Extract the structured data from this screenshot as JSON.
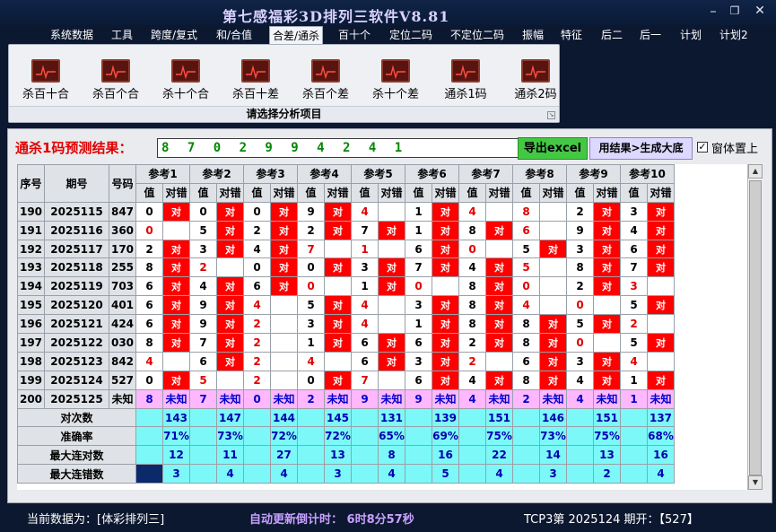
{
  "window": {
    "title": "第七感福彩3D排列三软件V8.81",
    "controls": [
      "minimize",
      "restore",
      "close"
    ]
  },
  "menu": [
    {
      "label": "系统数据",
      "active": false
    },
    {
      "label": "工具",
      "active": false
    },
    {
      "label": "跨度/复式",
      "active": false
    },
    {
      "label": "和/合值",
      "active": false
    },
    {
      "label": "合差/通杀",
      "active": true
    },
    {
      "label": "百十个",
      "active": false
    },
    {
      "label": "定位二码",
      "active": false
    },
    {
      "label": "不定位二码",
      "active": false
    },
    {
      "label": "振幅",
      "active": false
    },
    {
      "label": "特征",
      "active": false
    },
    {
      "label": "后二",
      "active": false
    },
    {
      "label": "后一",
      "active": false
    },
    {
      "label": "计划",
      "active": false
    },
    {
      "label": "计划2",
      "active": false
    }
  ],
  "ribbon": {
    "tools": [
      {
        "label": "杀百十合",
        "icon": "chart-icon"
      },
      {
        "label": "杀百个合",
        "icon": "chart-icon"
      },
      {
        "label": "杀十个合",
        "icon": "chart-icon"
      },
      {
        "label": "杀百十差",
        "icon": "chart-icon"
      },
      {
        "label": "杀百个差",
        "icon": "chart-icon"
      },
      {
        "label": "杀十个差",
        "icon": "chart-icon"
      },
      {
        "label": "通杀1码",
        "icon": "chart-icon"
      },
      {
        "label": "通杀2码",
        "icon": "chart-icon"
      }
    ],
    "footer": "请选择分析项目"
  },
  "result": {
    "label": "通杀1码预测结果：",
    "value": "8 7 0 2 9 9 4 2 4 1",
    "export_button": "导出excel",
    "generate_button": "用结果>生成大底",
    "ontop_checked": true,
    "ontop_label": "窗体置上"
  },
  "table": {
    "headers": {
      "index": "序号",
      "term": "期号",
      "code": "号码",
      "value": "值",
      "result": "对错"
    },
    "groups": [
      "参考1",
      "参考2",
      "参考3",
      "参考4",
      "参考5",
      "参考6",
      "参考7",
      "参考8",
      "参考9",
      "参考10"
    ],
    "hit_text": "对",
    "rows": [
      {
        "index": "190",
        "term": "2025115",
        "code": "847",
        "refs": [
          [
            "0",
            1
          ],
          [
            "0",
            1
          ],
          [
            "0",
            1
          ],
          [
            "9",
            1
          ],
          [
            "4",
            0
          ],
          [
            "1",
            1
          ],
          [
            "4",
            0
          ],
          [
            "8",
            0
          ],
          [
            "2",
            1
          ],
          [
            "3",
            1
          ]
        ]
      },
      {
        "index": "191",
        "term": "2025116",
        "code": "360",
        "refs": [
          [
            "0",
            0
          ],
          [
            "5",
            1
          ],
          [
            "2",
            1
          ],
          [
            "2",
            1
          ],
          [
            "7",
            1
          ],
          [
            "1",
            1
          ],
          [
            "8",
            1
          ],
          [
            "6",
            0
          ],
          [
            "9",
            1
          ],
          [
            "4",
            1
          ]
        ]
      },
      {
        "index": "192",
        "term": "2025117",
        "code": "170",
        "refs": [
          [
            "2",
            1
          ],
          [
            "3",
            1
          ],
          [
            "4",
            1
          ],
          [
            "7",
            0
          ],
          [
            "1",
            0
          ],
          [
            "6",
            1
          ],
          [
            "0",
            0
          ],
          [
            "5",
            1
          ],
          [
            "3",
            1
          ],
          [
            "6",
            1
          ]
        ]
      },
      {
        "index": "193",
        "term": "2025118",
        "code": "255",
        "refs": [
          [
            "8",
            1
          ],
          [
            "2",
            0
          ],
          [
            "0",
            1
          ],
          [
            "0",
            1
          ],
          [
            "3",
            1
          ],
          [
            "7",
            1
          ],
          [
            "4",
            1
          ],
          [
            "5",
            0
          ],
          [
            "8",
            1
          ],
          [
            "7",
            1
          ]
        ]
      },
      {
        "index": "194",
        "term": "2025119",
        "code": "703",
        "refs": [
          [
            "6",
            1
          ],
          [
            "4",
            1
          ],
          [
            "6",
            1
          ],
          [
            "0",
            0
          ],
          [
            "1",
            1
          ],
          [
            "0",
            0
          ],
          [
            "8",
            1
          ],
          [
            "0",
            0
          ],
          [
            "2",
            1
          ],
          [
            "3",
            0
          ]
        ]
      },
      {
        "index": "195",
        "term": "2025120",
        "code": "401",
        "refs": [
          [
            "6",
            1
          ],
          [
            "9",
            1
          ],
          [
            "4",
            0
          ],
          [
            "5",
            1
          ],
          [
            "4",
            0
          ],
          [
            "3",
            1
          ],
          [
            "8",
            1
          ],
          [
            "4",
            0
          ],
          [
            "0",
            0
          ],
          [
            "5",
            1
          ]
        ]
      },
      {
        "index": "196",
        "term": "2025121",
        "code": "424",
        "refs": [
          [
            "6",
            1
          ],
          [
            "9",
            1
          ],
          [
            "2",
            0
          ],
          [
            "3",
            1
          ],
          [
            "4",
            0
          ],
          [
            "1",
            1
          ],
          [
            "8",
            1
          ],
          [
            "8",
            1
          ],
          [
            "5",
            1
          ],
          [
            "2",
            0
          ]
        ]
      },
      {
        "index": "197",
        "term": "2025122",
        "code": "030",
        "refs": [
          [
            "8",
            1
          ],
          [
            "7",
            1
          ],
          [
            "2",
            0
          ],
          [
            "1",
            1
          ],
          [
            "6",
            1
          ],
          [
            "6",
            1
          ],
          [
            "2",
            1
          ],
          [
            "8",
            1
          ],
          [
            "0",
            0
          ],
          [
            "5",
            1
          ]
        ]
      },
      {
        "index": "198",
        "term": "2025123",
        "code": "842",
        "refs": [
          [
            "4",
            0
          ],
          [
            "6",
            1
          ],
          [
            "2",
            0
          ],
          [
            "4",
            0
          ],
          [
            "6",
            1
          ],
          [
            "3",
            1
          ],
          [
            "2",
            0
          ],
          [
            "6",
            1
          ],
          [
            "3",
            1
          ],
          [
            "4",
            0
          ]
        ]
      },
      {
        "index": "199",
        "term": "2025124",
        "code": "527",
        "refs": [
          [
            "0",
            1
          ],
          [
            "5",
            0
          ],
          [
            "2",
            0
          ],
          [
            "0",
            1
          ],
          [
            "7",
            0
          ],
          [
            "6",
            1
          ],
          [
            "4",
            1
          ],
          [
            "8",
            1
          ],
          [
            "4",
            1
          ],
          [
            "1",
            1
          ]
        ]
      },
      {
        "index": "200",
        "term": "2025125",
        "code": "未知",
        "pending": true,
        "refs": [
          [
            "8",
            "未知"
          ],
          [
            "7",
            "未知"
          ],
          [
            "0",
            "未知"
          ],
          [
            "2",
            "未知"
          ],
          [
            "9",
            "未知"
          ],
          [
            "9",
            "未知"
          ],
          [
            "4",
            "未知"
          ],
          [
            "2",
            "未知"
          ],
          [
            "4",
            "未知"
          ],
          [
            "1",
            "未知"
          ]
        ]
      }
    ],
    "stats": [
      {
        "label": "对次数",
        "values": [
          "143",
          "147",
          "144",
          "145",
          "131",
          "139",
          "151",
          "146",
          "151",
          "137"
        ]
      },
      {
        "label": "准确率",
        "values": [
          "71%",
          "73%",
          "72%",
          "72%",
          "65%",
          "69%",
          "75%",
          "73%",
          "75%",
          "68%"
        ]
      },
      {
        "label": "最大连对数",
        "values": [
          "12",
          "11",
          "27",
          "13",
          "8",
          "16",
          "22",
          "14",
          "13",
          "16"
        ]
      },
      {
        "label": "最大连错数",
        "values": [
          "3",
          "4",
          "4",
          "3",
          "4",
          "5",
          "4",
          "3",
          "2",
          "4"
        ]
      }
    ]
  },
  "status": {
    "data_source": "当前数据为：[体彩排列三]",
    "countdown": "自动更新倒计时：  6时8分57秒",
    "latest": "TCP3第 2025124 期开：【527】"
  },
  "colors": {
    "hit": "#ff0000",
    "pending_row": "#ffb8ff",
    "stats_bg": "#7cf8f8",
    "title_text": "#d8d2ff"
  }
}
